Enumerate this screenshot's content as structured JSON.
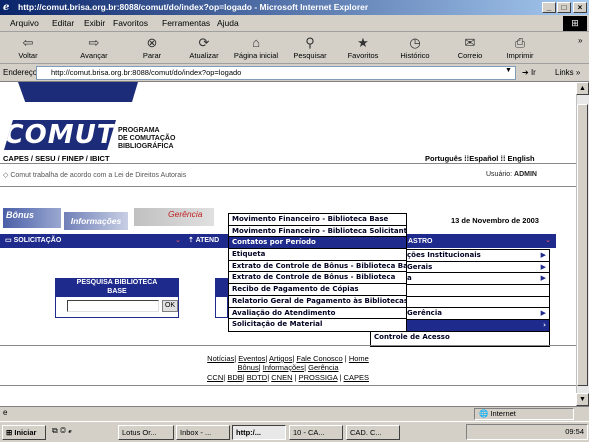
{
  "window": {
    "title": "http://comut.brisa.org.br:8088/comut/do/index?op=logado - Microsoft Internet Explorer"
  },
  "menubar": {
    "items": [
      "Arquivo",
      "Editar",
      "Exibir",
      "Favoritos",
      "Ferramentas",
      "Ajuda"
    ]
  },
  "toolbar": {
    "back": "Voltar",
    "forward": "Avançar",
    "stop": "Parar",
    "refresh": "Atualizar",
    "home": "Página inicial",
    "search": "Pesquisar",
    "favorites": "Favoritos",
    "history": "Histórico",
    "mail": "Correio",
    "print": "Imprimir"
  },
  "address": {
    "label": "Endereço",
    "url": "http://comut.brisa.org.br:8088/comut/do/index?op=logado",
    "go": "Ir",
    "links": "Links"
  },
  "page": {
    "logo": {
      "word": "COMUT",
      "line1": "PROGRAMA",
      "line2": "DE COMUTAÇÃO",
      "line3": "BIBLIOGRÁFICA",
      "sponsors": "CAPES / SESU / FINEP / IBICT"
    },
    "languages": [
      "Português",
      "Español",
      "English"
    ],
    "notice": "Comut trabalha de acordo com a Lei de Direitos Autorais",
    "user_label": "Usuário:",
    "user_name": "ADMIN",
    "tabs": [
      "Bônus",
      "Informações",
      "Gerência"
    ],
    "date": "13 de Novembro de 2003",
    "nav": {
      "solicitacao": "SOLICITAÇÃO",
      "atendimento": "ATEND",
      "cadastro": "ASTRO"
    },
    "dropdown": [
      "Movimento Financeiro - Biblioteca Base",
      "Movimento Financeiro - Biblioteca Solicitante",
      "Contatos por Período",
      "Etiqueta",
      "Extrato de Controle de Bônus - Biblioteca Base",
      "Extrato de Controle de Bônus - Biblioteca",
      "Recibo de Pagamento de Cópias",
      "Relatorio Geral de Pagamento às Bibliotecas",
      "Avaliação do Atendimento",
      "Solicitação de Material"
    ],
    "right_menu": [
      "ções Institucionais",
      "Gerais",
      "a",
      "",
      "",
      "Gerência",
      "",
      "Controle de Acesso"
    ],
    "search_box": {
      "title_line1": "PESQUISA BIBLIOTECA",
      "title_line2": "BASE",
      "ok": "OK"
    },
    "footer_links1": [
      "Notícias",
      "Eventos",
      "Artigos",
      "Fale Conosco",
      "Home"
    ],
    "footer_links2": [
      "Bônus",
      "Informações",
      "Gerência"
    ],
    "footer_links3": [
      "CCN",
      "BDB",
      "BDTD",
      "CNEN",
      "PROSSIGA",
      "CAPES"
    ]
  },
  "status": {
    "zone": "Internet"
  },
  "taskbar": {
    "start": "Iniciar",
    "tasks": [
      "Lotus Or...",
      "Inbox - ...",
      "http:/...",
      "10 - CA...",
      "CAD. C..."
    ],
    "clock": "09:54"
  }
}
